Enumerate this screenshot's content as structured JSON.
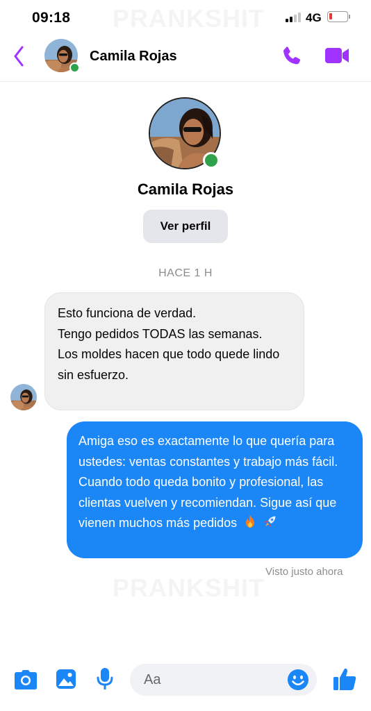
{
  "colors": {
    "accent_purple": "#a033ff",
    "blue": "#1b86f5",
    "online_green": "#31a24c",
    "battery_red": "#e53935"
  },
  "status_bar": {
    "time": "09:18",
    "network": "4G",
    "battery_level": 0.15
  },
  "watermark": "PRANKSHIT",
  "header": {
    "contact_name": "Camila Rojas",
    "icons": [
      "back-chevron-icon",
      "phone-icon",
      "video-camera-icon"
    ]
  },
  "profile": {
    "name": "Camila Rojas",
    "view_profile_label": "Ver perfil"
  },
  "conversation": {
    "timestamp": "HACE 1 H",
    "messages": [
      {
        "direction": "incoming",
        "lines": [
          "Esto funciona de verdad.",
          "Tengo pedidos TODAS las semanas.",
          "Los moldes hacen que todo quede lindo sin esfuerzo."
        ]
      },
      {
        "direction": "outgoing",
        "text": "Amiga eso es exactamente lo que quería para ustedes: ventas constantes y trabajo más fácil. Cuando todo queda bonito y profesional, las clientas vuelven y recomiendan. Sigue así que vienen muchos más pedidos",
        "emojis": [
          "fire-emoji",
          "rocket-emoji"
        ]
      }
    ],
    "seen_status": "Visto justo ahora"
  },
  "composer": {
    "placeholder": "Aa",
    "icons": [
      "camera-icon",
      "image-icon",
      "microphone-icon",
      "emoji-icon",
      "thumbs-up-icon"
    ]
  }
}
